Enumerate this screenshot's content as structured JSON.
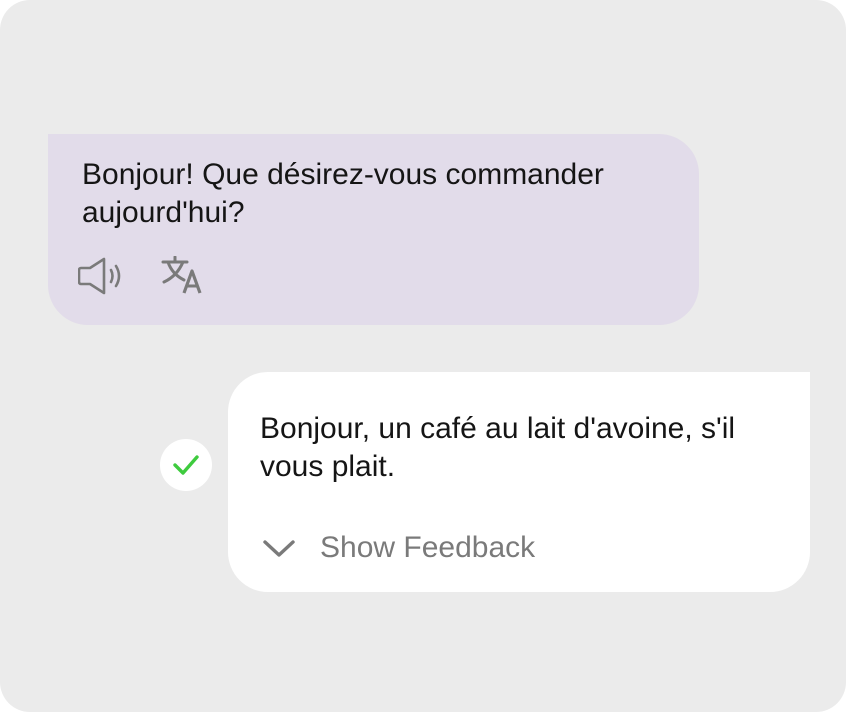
{
  "conversation": {
    "ai_message": {
      "text": "Bonjour! Que désirez-vous commander aujourd'hui?",
      "actions": [
        {
          "icon": "speaker-icon"
        },
        {
          "icon": "translate-icon"
        }
      ]
    },
    "user_message": {
      "text": "Bonjour, un café au lait d'avoine, s'il vous plait.",
      "status_icon": "check-icon",
      "status_color": "#3ecb3e",
      "feedback_toggle_label": "Show Feedback",
      "feedback_toggle_icon": "chevron-down-icon"
    }
  },
  "colors": {
    "background": "#ebebeb",
    "ai_bubble": "#e2dcea",
    "user_bubble": "#ffffff",
    "icon_gray": "#7a7a7a",
    "text": "#151515"
  }
}
